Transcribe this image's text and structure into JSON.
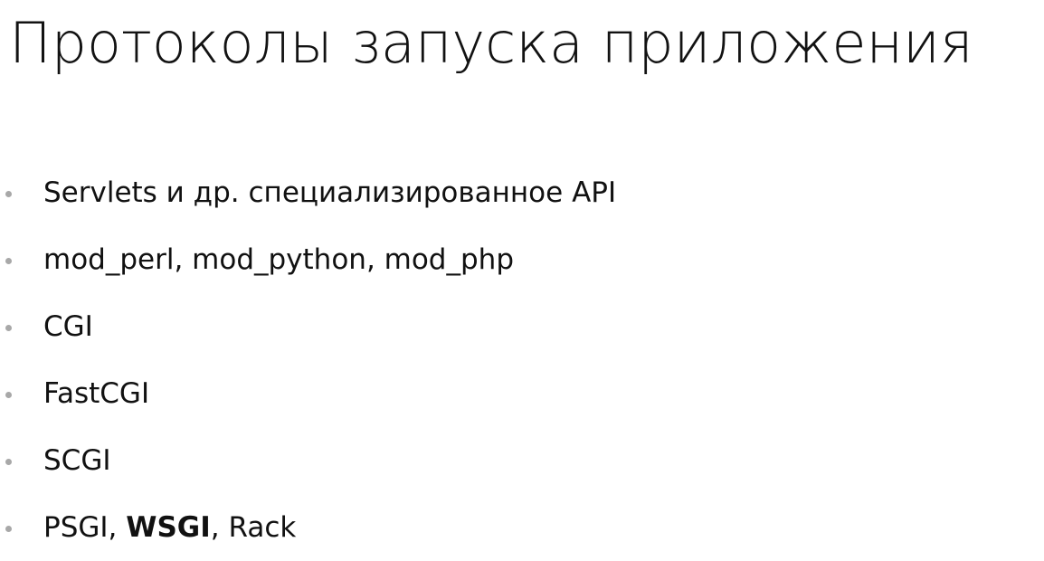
{
  "slide": {
    "title": "Протоколы запуска приложения",
    "bullet_color": "#a8a8a8",
    "text_color": "#111111",
    "bullets": [
      {
        "parts": [
          "Servlets и др. специализированное API"
        ]
      },
      {
        "parts": [
          "mod_perl, mod_python, mod_php"
        ]
      },
      {
        "parts": [
          "CGI"
        ]
      },
      {
        "parts": [
          "FastCGI"
        ]
      },
      {
        "parts": [
          "SCGI"
        ]
      },
      {
        "parts": [
          "PSGI, ",
          "WSGI",
          ", Rack"
        ],
        "bold_part": 1
      }
    ]
  }
}
